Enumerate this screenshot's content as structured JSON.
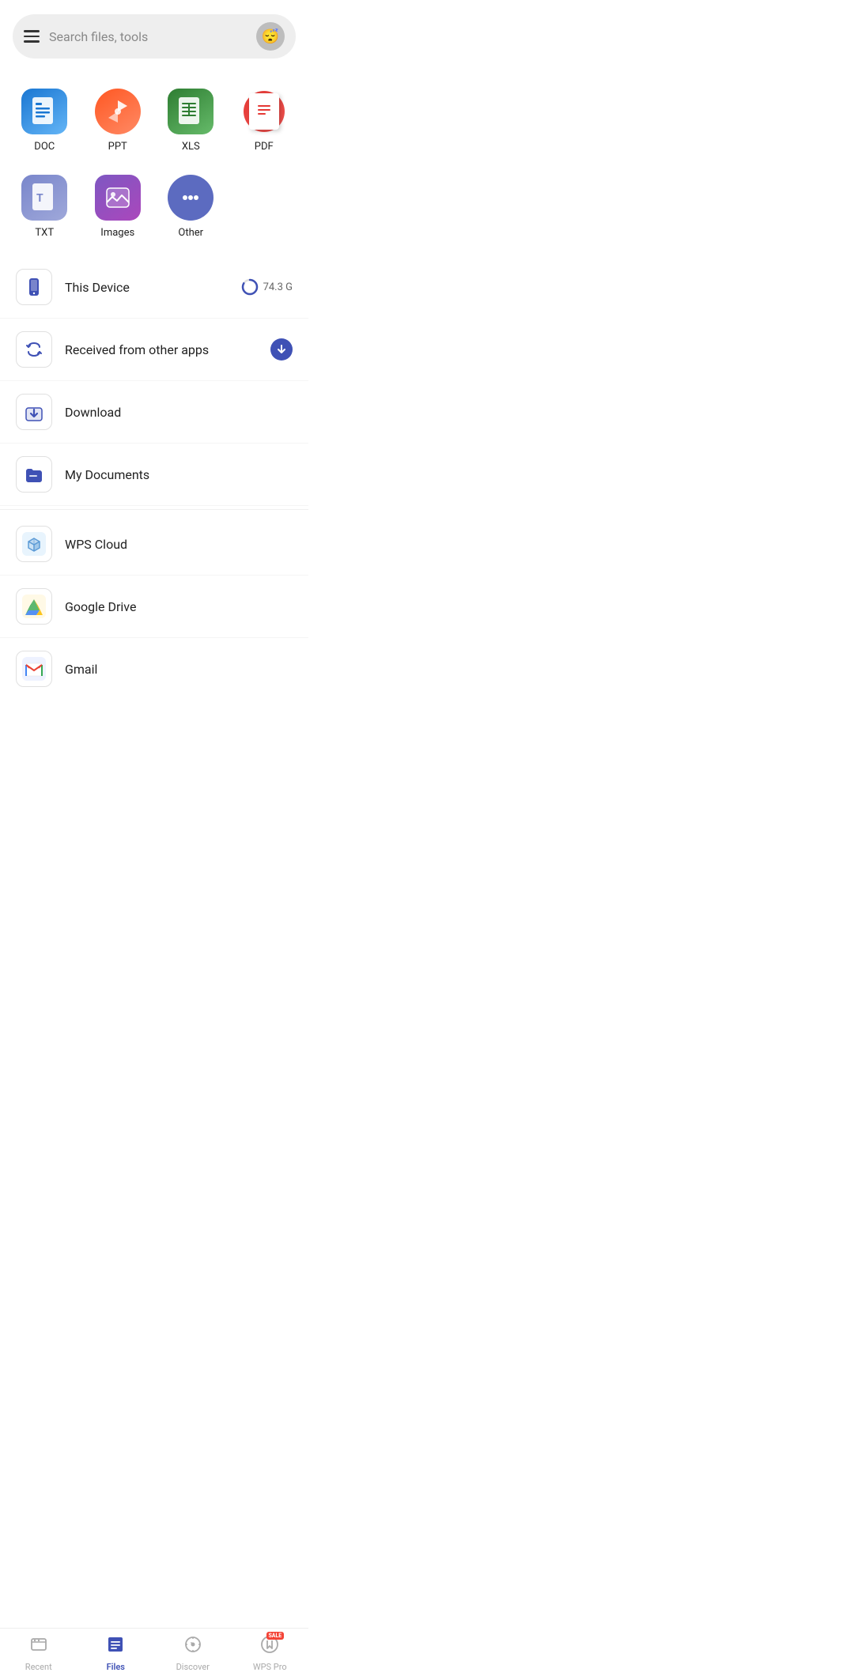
{
  "header": {
    "search_placeholder": "Search files, tools",
    "avatar_emoji": "😴"
  },
  "file_types": [
    {
      "id": "doc",
      "label": "DOC",
      "color_start": "#1565C0",
      "color_end": "#42A5F5"
    },
    {
      "id": "ppt",
      "label": "PPT",
      "color_start": "#FF7043",
      "color_end": "#FF8A65"
    },
    {
      "id": "xls",
      "label": "XLS",
      "color_start": "#2E7D32",
      "color_end": "#43A047"
    },
    {
      "id": "pdf",
      "label": "PDF",
      "color_start": "#E53935",
      "color_end": "#EF9A9A"
    },
    {
      "id": "txt",
      "label": "TXT",
      "color_start": "#7986CB",
      "color_end": "#9FA8DA"
    },
    {
      "id": "images",
      "label": "Images",
      "color_start": "#7E57C2",
      "color_end": "#AB47BC"
    },
    {
      "id": "other",
      "label": "Other",
      "color": "#5C6BC0"
    }
  ],
  "storage_items": [
    {
      "id": "this-device",
      "label": "This Device",
      "badge": "74.3 G",
      "has_progress": true
    },
    {
      "id": "received",
      "label": "Received from other apps",
      "has_download": true
    },
    {
      "id": "download",
      "label": "Download",
      "has_download_icon": true
    },
    {
      "id": "my-documents",
      "label": "My Documents"
    },
    {
      "id": "wps-cloud",
      "label": "WPS Cloud"
    },
    {
      "id": "google-drive",
      "label": "Google Drive"
    },
    {
      "id": "gmail",
      "label": "Gmail"
    }
  ],
  "bottom_nav": [
    {
      "id": "recent",
      "label": "Recent",
      "active": false
    },
    {
      "id": "files",
      "label": "Files",
      "active": true
    },
    {
      "id": "discover",
      "label": "Discover",
      "active": false
    },
    {
      "id": "wps-pro",
      "label": "WPS Pro",
      "active": false,
      "has_sale": true
    }
  ]
}
